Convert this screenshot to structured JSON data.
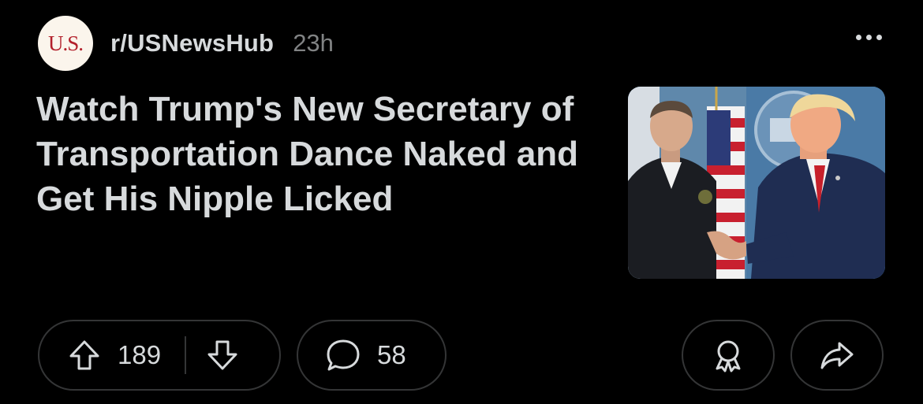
{
  "post": {
    "avatar_text": "U.S.",
    "subreddit": "r/USNewsHub",
    "age": "23h",
    "title": "Watch Trump's New Secretary of Transportation Dance Naked and Get His Nipple Licked",
    "upvotes": "189",
    "comments": "58"
  },
  "icons": {
    "more": "more-options-icon",
    "upvote": "upvote-arrow-icon",
    "downvote": "downvote-arrow-icon",
    "comment": "comment-bubble-icon",
    "award": "award-icon",
    "share": "share-arrow-icon"
  },
  "colors": {
    "background": "#000000",
    "text": "#d7dadc",
    "muted": "#818384",
    "pill_border": "#343536",
    "avatar_bg": "#fbf5ec",
    "avatar_text": "#b3202b"
  }
}
